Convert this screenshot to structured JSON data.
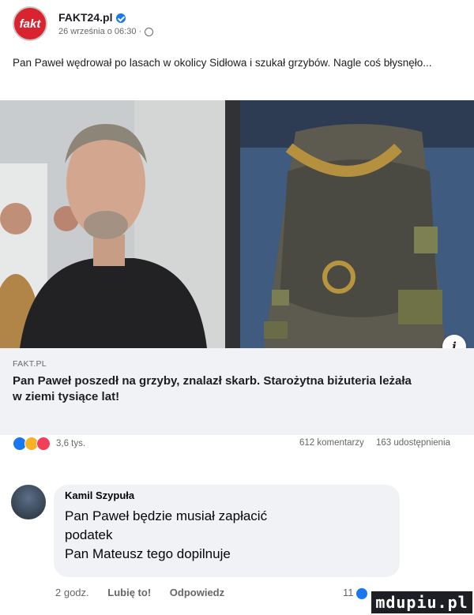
{
  "post": {
    "page_name": "FAKT24.pl",
    "logo_text": "fakt",
    "timestamp": "26 września o 06:30 ·",
    "text": "Pan Paweł wędrował po lasach w okolicy Sidłowa i szukał grzybów. Nagle coś błysnęło..."
  },
  "link_preview": {
    "source": "FAKT.PL",
    "title": "Pan Paweł poszedł na grzyby, znalazł skarb. Starożytna biżuteria leżała w ziemi tysiące lat!"
  },
  "stats": {
    "reactions_count": "3,6 tys.",
    "comments": "612 komentarzy",
    "shares": "163 udostępnienia"
  },
  "comment": {
    "author": "Kamil Szypuła",
    "text_line1": "Pan Paweł będzie musiał zapłacić",
    "text_line2": "podatek",
    "text_line3": "Pan Mateusz tego dopilnuje",
    "time": "2 godz.",
    "like_label": "Lubię to!",
    "reply_label": "Odpowiedz",
    "like_count": "11"
  },
  "info_badge": "i",
  "watermark": "mdupiu.pl"
}
